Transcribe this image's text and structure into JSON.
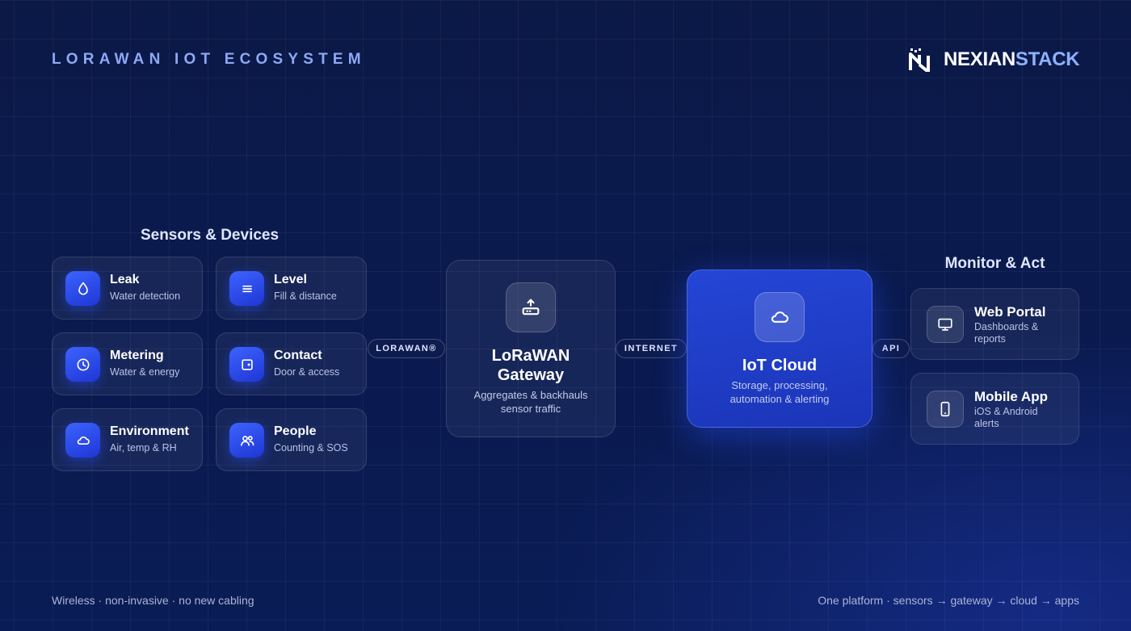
{
  "header": {
    "title": "LORAWAN IOT ECOSYSTEM",
    "logo_part1": "NEXIAN",
    "logo_part2": "STACK"
  },
  "sensors": {
    "title": "Sensors & Devices",
    "items": [
      {
        "name": "Leak",
        "sub": "Water detection",
        "icon": "droplet-icon"
      },
      {
        "name": "Level",
        "sub": "Fill & distance",
        "icon": "lines-icon"
      },
      {
        "name": "Metering",
        "sub": "Water & energy",
        "icon": "clock-icon"
      },
      {
        "name": "Contact",
        "sub": "Door & access",
        "icon": "door-icon"
      },
      {
        "name": "Environment",
        "sub": "Air, temp & RH",
        "icon": "cloud-icon"
      },
      {
        "name": "People",
        "sub": "Counting & SOS",
        "icon": "people-icon"
      }
    ]
  },
  "connectors": {
    "lorawan": "LORAWAN®",
    "internet": "INTERNET",
    "api": "API"
  },
  "gateway": {
    "name_line1": "LoRaWAN",
    "name_line2": "Gateway",
    "sub_line1": "Aggregates & backhauls",
    "sub_line2": "sensor traffic",
    "icon": "router-icon"
  },
  "cloud": {
    "name": "IoT Cloud",
    "sub_line1": "Storage, processing,",
    "sub_line2": "automation & alerting",
    "icon": "cloud-icon"
  },
  "monitor": {
    "title": "Monitor & Act",
    "items": [
      {
        "name": "Web Portal",
        "sub": "Dashboards & reports",
        "icon": "monitor-icon"
      },
      {
        "name": "Mobile App",
        "sub": "iOS & Android alerts",
        "icon": "phone-icon"
      }
    ]
  },
  "footer": {
    "left": "Wireless · non-invasive · no new cabling",
    "right": "One platform · sensors → gateway → cloud → apps"
  },
  "colors": {
    "background": "#0a1a4f",
    "accent": "#2446d6",
    "title": "#8fa8f5",
    "logo_accent": "#8fb0ff"
  }
}
